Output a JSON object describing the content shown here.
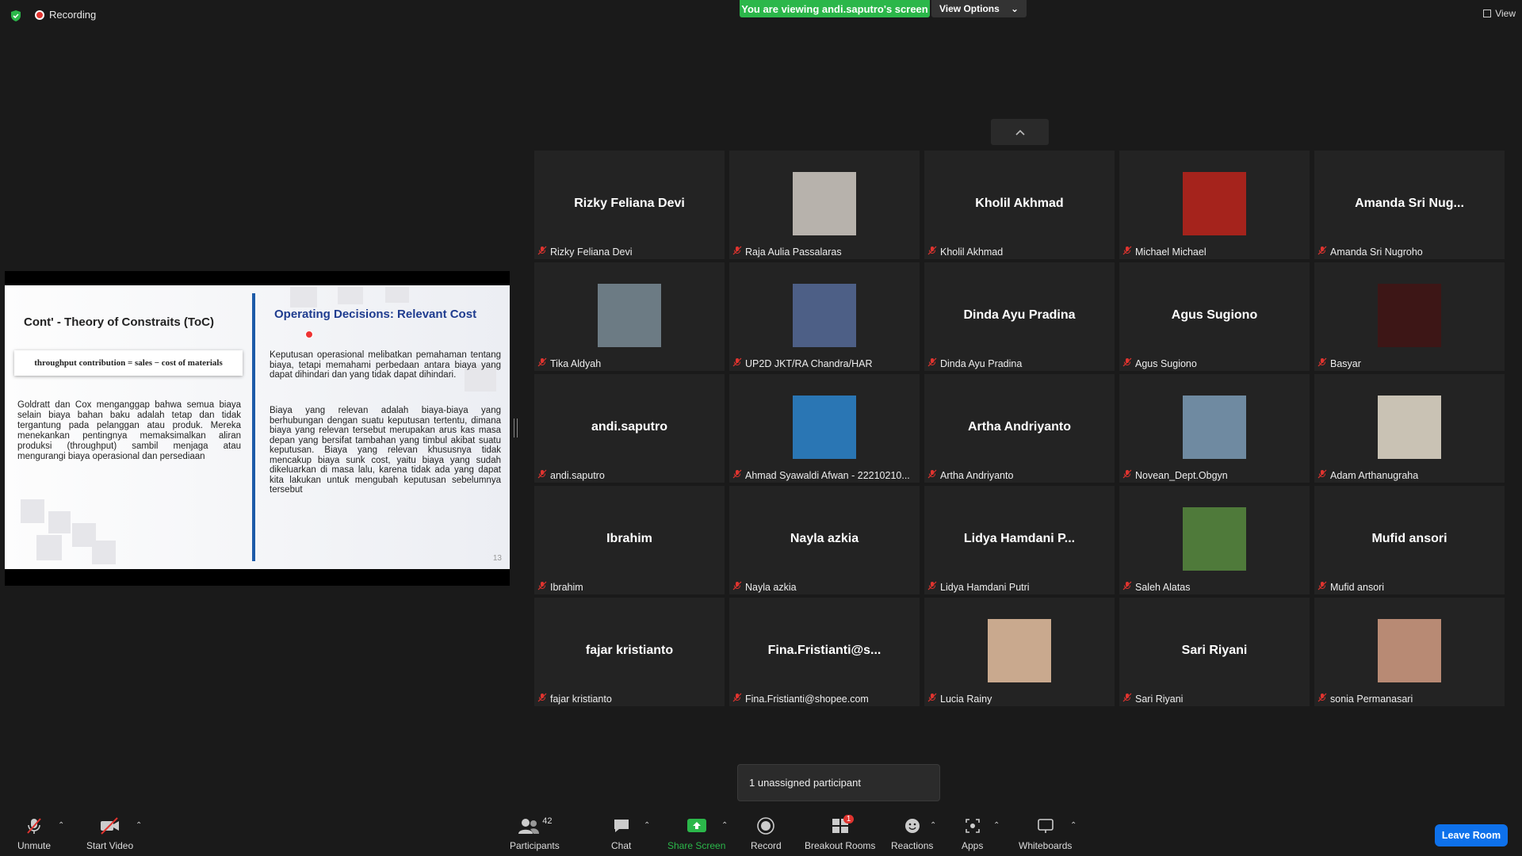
{
  "top": {
    "recording": "Recording",
    "viewing_banner": "You are viewing andi.saputro's screen",
    "view_options": "View Options",
    "view": "View"
  },
  "slide": {
    "left_title": "Cont' - Theory of Constraits (ToC)",
    "formula": "throughput contribution = sales − cost of materials",
    "left_paragraph": "Goldratt dan Cox menganggap bahwa semua biaya selain biaya bahan baku adalah tetap dan tidak tergantung pada pelanggan atau produk. Mereka menekankan pentingnya memaksimalkan aliran produksi (throughput) sambil menjaga atau mengurangi biaya operasional dan persediaan",
    "right_title": "Operating Decisions: Relevant Cost",
    "right_paragraph_1": "Keputusan operasional melibatkan pemahaman tentang biaya, tetapi memahami perbedaan antara biaya yang dapat dihindari dan yang tidak dapat dihindari.",
    "right_paragraph_2": "Biaya yang relevan adalah biaya-biaya yang berhubungan dengan suatu keputusan tertentu, dimana biaya yang relevan tersebut merupakan arus kas masa depan yang bersifat tambahan yang timbul akibat suatu keputusan. Biaya yang relevan khususnya tidak mencakup biaya sunk cost, yaitu biaya yang sudah dikeluarkan di masa lalu, karena tidak ada yang dapat kita lakukan untuk mengubah keputusan sebelumnya tersebut",
    "page_number": "13"
  },
  "participants_grid": [
    {
      "display": "Rizky Feliana Devi",
      "label": "Rizky Feliana Devi",
      "photo": null
    },
    {
      "display": "",
      "label": "Raja Aulia Passalaras",
      "photo": "#b7b2ac"
    },
    {
      "display": "Kholil Akhmad",
      "label": "Kholil Akhmad",
      "photo": null
    },
    {
      "display": "",
      "label": "Michael Michael",
      "photo": "#a5231c"
    },
    {
      "display": "Amanda Sri Nug...",
      "label": "Amanda Sri Nugroho",
      "photo": null
    },
    {
      "display": "",
      "label": "Tika Aldyah",
      "photo": "#6c7b84"
    },
    {
      "display": "",
      "label": "UP2D JKT/RA Chandra/HAR",
      "photo": "#4d5f86"
    },
    {
      "display": "Dinda Ayu Pradina",
      "label": "Dinda Ayu Pradina",
      "photo": null
    },
    {
      "display": "Agus Sugiono",
      "label": "Agus Sugiono",
      "photo": null
    },
    {
      "display": "",
      "label": "Basyar",
      "photo": "#3d1616"
    },
    {
      "display": "andi.saputro",
      "label": "andi.saputro",
      "photo": null
    },
    {
      "display": "",
      "label": "Ahmad Syawaldi Afwan - 22210210...",
      "photo": "#2a76b4"
    },
    {
      "display": "Artha Andriyanto",
      "label": "Artha Andriyanto",
      "photo": null
    },
    {
      "display": "",
      "label": "Novean_Dept.Obgyn",
      "photo": "#6f8aa1"
    },
    {
      "display": "",
      "label": "Adam Arthanugraha",
      "photo": "#c9c2b4"
    },
    {
      "display": "Ibrahim",
      "label": "Ibrahim",
      "photo": null
    },
    {
      "display": "Nayla azkia",
      "label": "Nayla azkia",
      "photo": null
    },
    {
      "display": "Lidya Hamdani P...",
      "label": "Lidya Hamdani Putri",
      "photo": null
    },
    {
      "display": "",
      "label": "Saleh Alatas",
      "photo": "#4f7a3a"
    },
    {
      "display": "Mufid ansori",
      "label": "Mufid ansori",
      "photo": null
    },
    {
      "display": "fajar kristianto",
      "label": "fajar kristianto",
      "photo": null
    },
    {
      "display": "Fina.Fristianti@s...",
      "label": "Fina.Fristianti@shopee.com",
      "photo": null
    },
    {
      "display": "",
      "label": "Lucia Rainy",
      "photo": "#c9a98e"
    },
    {
      "display": "Sari Riyani",
      "label": "Sari Riyani",
      "photo": null
    },
    {
      "display": "",
      "label": "sonia Permanasari",
      "photo": "#b88a74"
    }
  ],
  "popup": {
    "unassigned": "1 unassigned participant"
  },
  "toolbar": {
    "unmute": "Unmute",
    "start_video": "Start Video",
    "participants": "Participants",
    "participants_count": "42",
    "chat": "Chat",
    "share_screen": "Share Screen",
    "record": "Record",
    "breakout_rooms": "Breakout Rooms",
    "breakout_badge": "1",
    "reactions": "Reactions",
    "apps": "Apps",
    "whiteboards": "Whiteboards",
    "leave_room": "Leave Room"
  },
  "colors": {
    "share_green": "#2bb74a",
    "leave_blue": "#0e71eb",
    "muted_red": "#e0342f"
  }
}
